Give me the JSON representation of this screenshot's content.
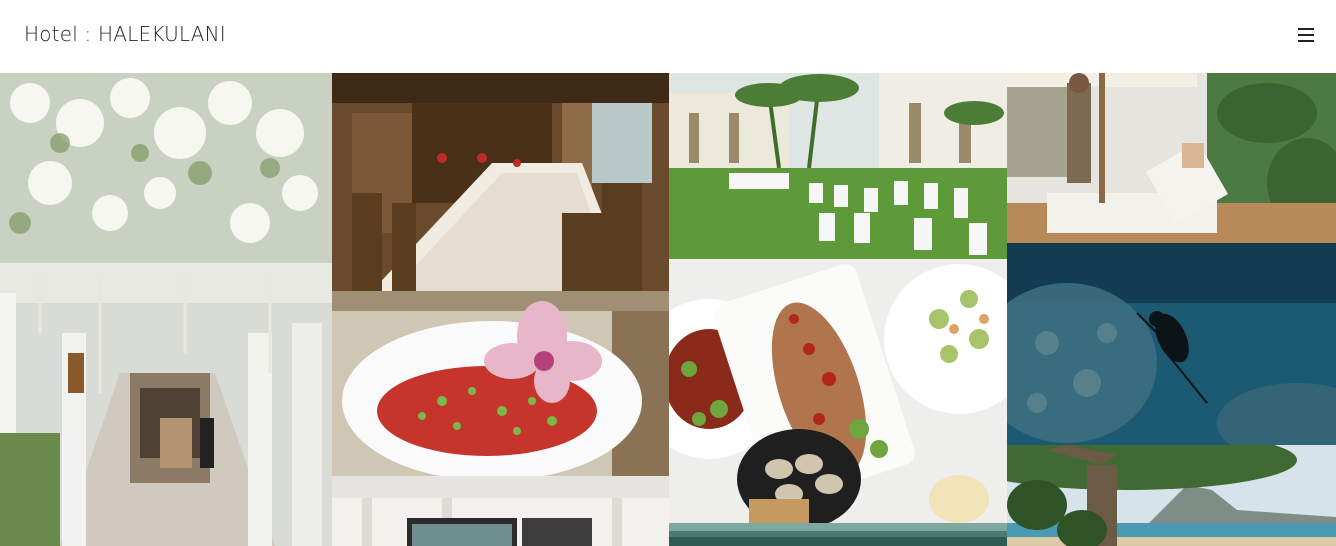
{
  "header": {
    "title": "Hotel : HALEKULANI",
    "menu_icon": "hamburger-menu-icon"
  },
  "gallery": {
    "photos": [
      {
        "subject": "flower-covered colonnade walkway"
      },
      {
        "subject": "private dining room table"
      },
      {
        "subject": "poke bowl with orchid"
      },
      {
        "subject": "white interior room"
      },
      {
        "subject": "garden wedding ceremony chairs"
      },
      {
        "subject": "shared plates and clams"
      },
      {
        "subject": "ocean view sliver"
      },
      {
        "subject": "poolside lounger service"
      },
      {
        "subject": "underwater freediver"
      },
      {
        "subject": "beach tree and Diamond Head"
      }
    ]
  },
  "colors": {
    "background": "#ffffff",
    "text": "#222222",
    "grass": "#5f9a3a",
    "ocean": "#1b5a72"
  }
}
